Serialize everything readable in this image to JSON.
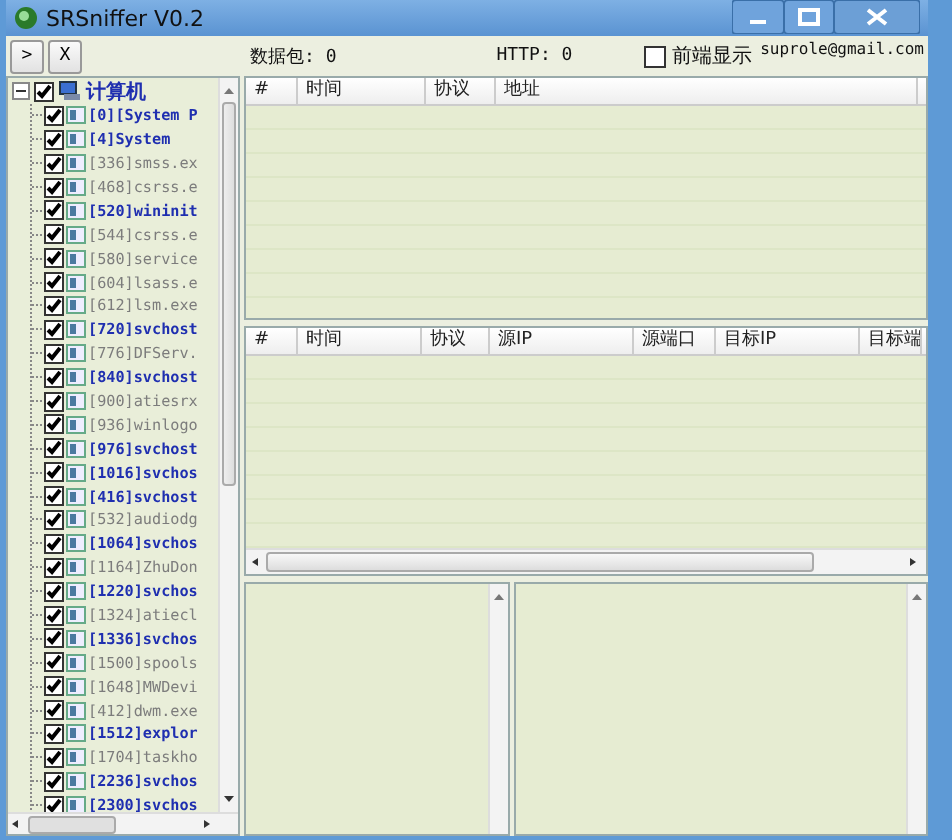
{
  "window": {
    "title": "SRSniffer V0.2"
  },
  "toolbar": {
    "buttons": [
      ">",
      "X"
    ],
    "packets": "数据包: 0",
    "http": "HTTP: 0",
    "front_display": {
      "label": "前端显示",
      "checked": false
    },
    "email": "suprole@gmail.com"
  },
  "tree": {
    "root": {
      "label": "计算机",
      "checked": true,
      "expanded": true,
      "children": [
        {
          "label": "[0][System P",
          "checked": true,
          "highlighted": true
        },
        {
          "label": "[4]System",
          "checked": true,
          "highlighted": true
        },
        {
          "label": "[336]smss.ex",
          "checked": true,
          "highlighted": false
        },
        {
          "label": "[468]csrss.e",
          "checked": true,
          "highlighted": false
        },
        {
          "label": "[520]wininit",
          "checked": true,
          "highlighted": true
        },
        {
          "label": "[544]csrss.e",
          "checked": true,
          "highlighted": false
        },
        {
          "label": "[580]service",
          "checked": true,
          "highlighted": false
        },
        {
          "label": "[604]lsass.e",
          "checked": true,
          "highlighted": false
        },
        {
          "label": "[612]lsm.exe",
          "checked": true,
          "highlighted": false
        },
        {
          "label": "[720]svchost",
          "checked": true,
          "highlighted": true
        },
        {
          "label": "[776]DFServ.",
          "checked": true,
          "highlighted": false
        },
        {
          "label": "[840]svchost",
          "checked": true,
          "highlighted": true
        },
        {
          "label": "[900]atiesrx",
          "checked": true,
          "highlighted": false
        },
        {
          "label": "[936]winlogo",
          "checked": true,
          "highlighted": false
        },
        {
          "label": "[976]svchost",
          "checked": true,
          "highlighted": true
        },
        {
          "label": "[1016]svchos",
          "checked": true,
          "highlighted": true
        },
        {
          "label": "[416]svchost",
          "checked": true,
          "highlighted": true
        },
        {
          "label": "[532]audiodg",
          "checked": true,
          "highlighted": false
        },
        {
          "label": "[1064]svchos",
          "checked": true,
          "highlighted": true
        },
        {
          "label": "[1164]ZhuDon",
          "checked": true,
          "highlighted": false
        },
        {
          "label": "[1220]svchos",
          "checked": true,
          "highlighted": true
        },
        {
          "label": "[1324]atiecl",
          "checked": true,
          "highlighted": false
        },
        {
          "label": "[1336]svchos",
          "checked": true,
          "highlighted": true
        },
        {
          "label": "[1500]spools",
          "checked": true,
          "highlighted": false
        },
        {
          "label": "[1648]MWDevi",
          "checked": true,
          "highlighted": false
        },
        {
          "label": "[412]dwm.exe",
          "checked": true,
          "highlighted": false
        },
        {
          "label": "[1512]explor",
          "checked": true,
          "highlighted": true
        },
        {
          "label": "[1704]taskho",
          "checked": true,
          "highlighted": false
        },
        {
          "label": "[2236]svchos",
          "checked": true,
          "highlighted": true
        },
        {
          "label": "[2300]svchos",
          "checked": true,
          "highlighted": true
        }
      ]
    }
  },
  "packet_list": {
    "columns": [
      "#",
      "时间",
      "协议",
      "地址"
    ]
  },
  "connection_list": {
    "columns": [
      "#",
      "时间",
      "协议",
      "源IP",
      "源端口",
      "目标IP",
      "目标端"
    ]
  }
}
